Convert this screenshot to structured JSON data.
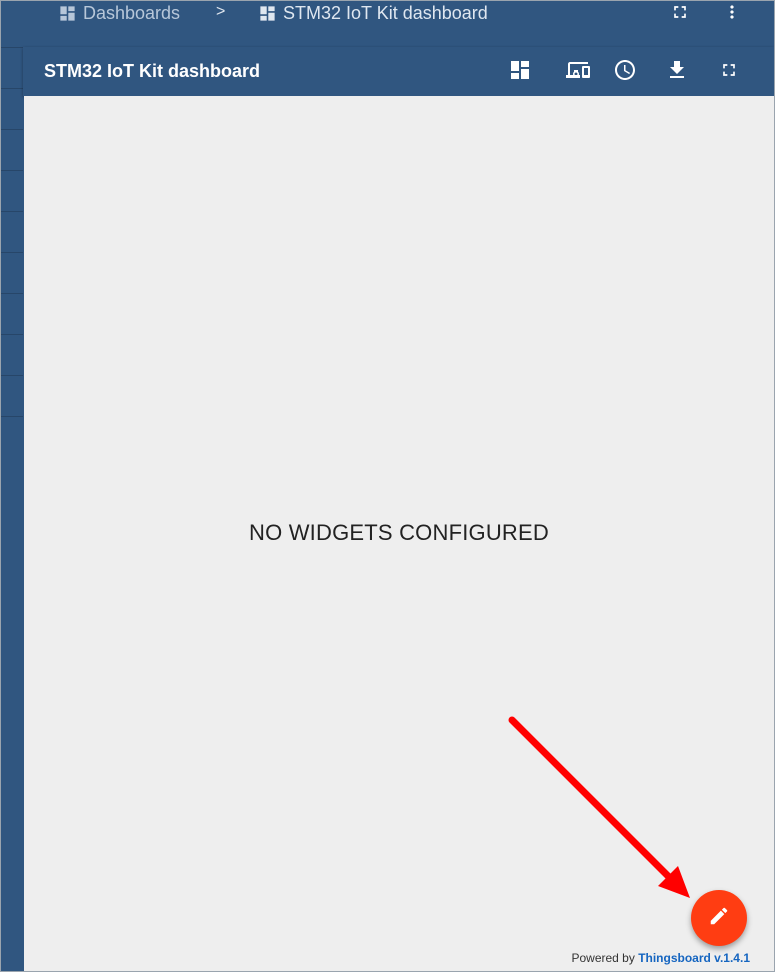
{
  "breadcrumb": {
    "items": [
      {
        "label": "Dashboards",
        "icon": "dashboards-icon"
      },
      {
        "label": "STM32 IoT Kit dashboard",
        "icon": "dashboard-icon"
      }
    ],
    "separator": ">"
  },
  "top_actions": [
    "fullscreen-icon",
    "more-vert-icon"
  ],
  "dashboard": {
    "title": "STM32 IoT Kit dashboard",
    "toolbar_icons": [
      "layout-icon",
      "devices-icon",
      "history-icon",
      "download-icon",
      "fullscreen-icon"
    ],
    "empty_message": "NO WIDGETS CONFIGURED"
  },
  "footer": {
    "prefix": "Powered by",
    "link": "Thingsboard v.1.4.1"
  },
  "colors": {
    "primary": "#305680",
    "content_bg": "#eeeeee",
    "fab": "#ff3d12",
    "arrow": "#ff0000",
    "link": "#1565c0"
  },
  "fab_icon": "edit-pencil-icon"
}
